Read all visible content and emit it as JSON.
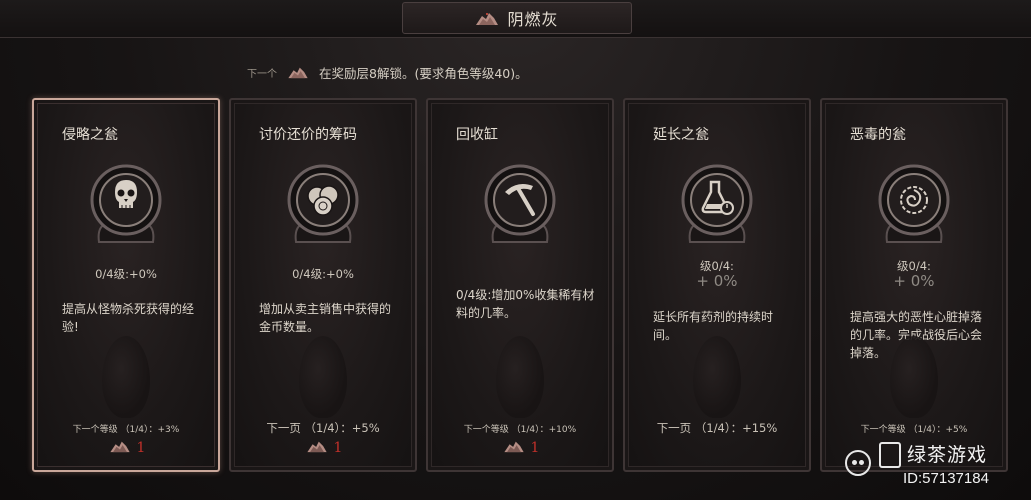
{
  "header": {
    "title": "阴燃灰",
    "icon": "ash-pile-icon"
  },
  "unlock": {
    "next_label": "下一个",
    "text": "在奖励层8解锁。(要求角色等级40)。"
  },
  "colors": {
    "accent_selected": "#c9a79a",
    "cost_red": "#c0302a",
    "card_bg": "#1c1818"
  },
  "cards": [
    {
      "title": "侵略之瓮",
      "icon": "skull-icon",
      "level": "0/4级:+0%",
      "description": "提高从怪物杀死获得的经验!",
      "next_level": "下一个等级 （1/4）：+3%",
      "cost": "1",
      "selected": true
    },
    {
      "title": "讨价还价的筹码",
      "icon": "coins-icon",
      "level": "0/4级:+0%",
      "description": "增加从卖主销售中获得的金币数量。",
      "next_level": "下一页 （1/4）：+5%",
      "cost": "1",
      "selected": false
    },
    {
      "title": "回收缸",
      "icon": "pickaxe-icon",
      "level": "",
      "description": "0/4级:增加0%收集稀有材料的几率。",
      "next_level": "下一个等级 （1/4）：+10%",
      "cost": "1",
      "selected": false
    },
    {
      "title": "延长之瓮",
      "icon": "potion-timer-icon",
      "level": "级0/4:",
      "bonus": "+ 0%",
      "description": "延长所有药剂的持续时间。",
      "next_level": "下一页 （1/4）：+15%",
      "cost": "",
      "selected": false
    },
    {
      "title": "恶毒的瓮",
      "icon": "heart-swirl-icon",
      "level": "级0/4:",
      "bonus": "+ 0%",
      "description": "提高强大的恶性心脏掉落的几率。完成战役后心会掉落。",
      "next_level": "下一个等级 （1/4）：+5%",
      "cost": "",
      "selected": false
    }
  ],
  "watermark": {
    "name": "绿茶游戏",
    "id": "ID:57137184"
  }
}
